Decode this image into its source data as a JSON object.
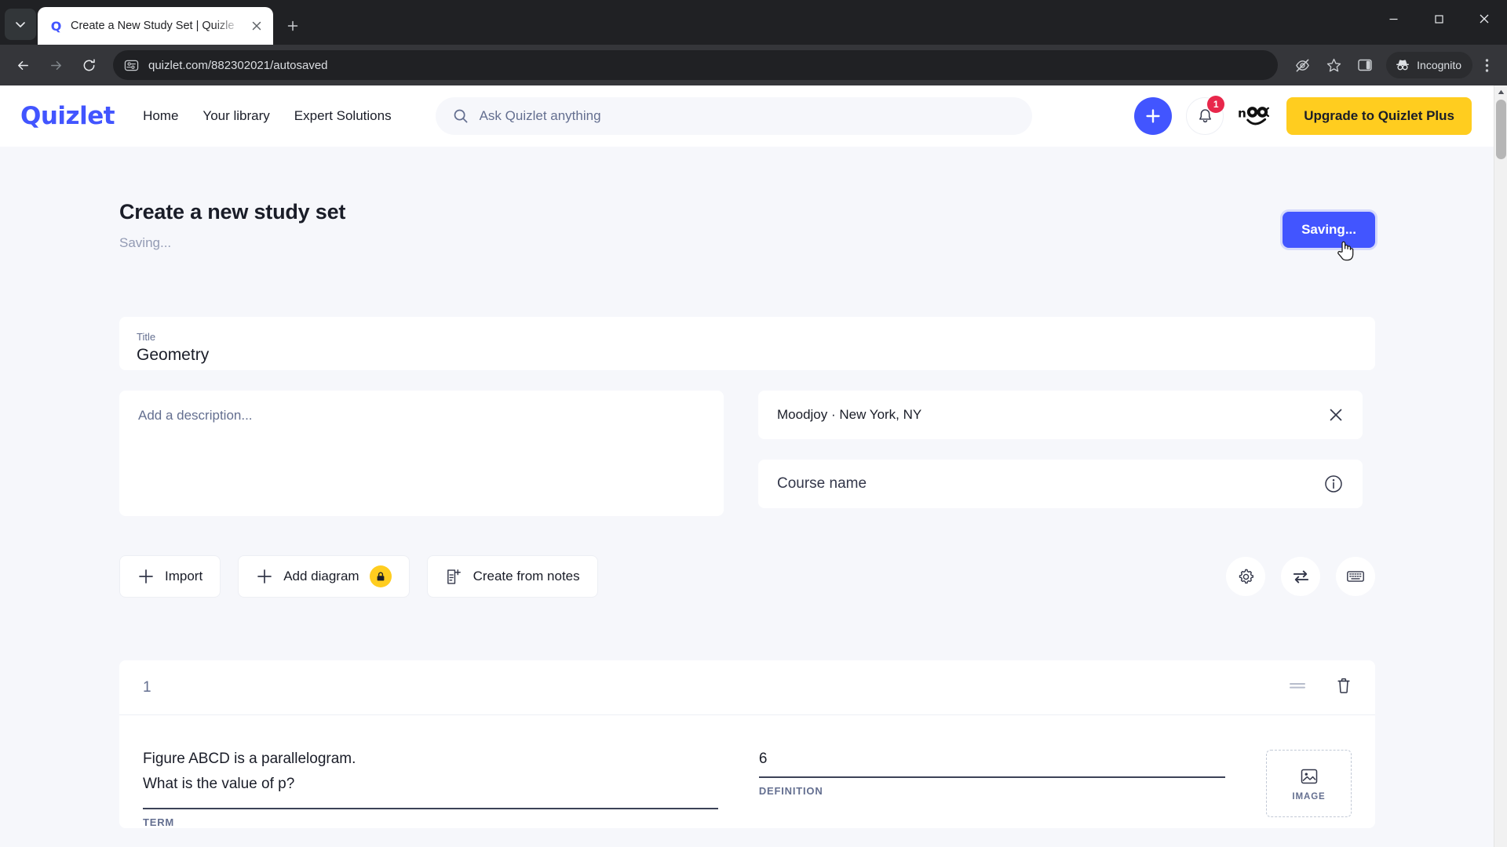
{
  "browser": {
    "tab": {
      "title": "Create a New Study Set | Quizle",
      "favicon": "Q"
    },
    "new_tab_label": "+",
    "window": {
      "minimize": "−",
      "maximize": "□",
      "close": "✕"
    },
    "url": "quizlet.com/882302021/autosaved",
    "incognito_label": "Incognito"
  },
  "header": {
    "logo": "Quizlet",
    "nav": [
      {
        "label": "Home"
      },
      {
        "label": "Your library"
      },
      {
        "label": "Expert Solutions"
      }
    ],
    "search_placeholder": "Ask Quizlet anything",
    "notification_count": "1",
    "upgrade_label": "Upgrade to Quizlet Plus"
  },
  "page": {
    "title": "Create a new study set",
    "saving_status": "Saving...",
    "save_button": "Saving...",
    "title_field": {
      "label": "Title",
      "value": "Geometry"
    },
    "description_placeholder": "Add a description...",
    "school_field": {
      "value": "Moodjoy · New York, NY"
    },
    "course_field": {
      "placeholder": "Course name"
    },
    "actions": [
      {
        "label": "Import",
        "icon": "plus-icon",
        "locked": false
      },
      {
        "label": "Add diagram",
        "icon": "plus-icon",
        "locked": true
      },
      {
        "label": "Create from notes",
        "icon": "notes-icon",
        "locked": false
      }
    ],
    "tool_icons": [
      {
        "name": "settings-gear-icon"
      },
      {
        "name": "swap-arrows-icon"
      },
      {
        "name": "keyboard-icon"
      }
    ],
    "cards": [
      {
        "number": "1",
        "term": "Figure ABCD is a parallelogram.\nWhat is the value of p?",
        "term_label": "TERM",
        "definition": "6",
        "definition_label": "DEFINITION",
        "image_label": "IMAGE"
      }
    ]
  },
  "colors": {
    "brand_blue": "#4255ff",
    "plus_yellow": "#ffcd1f",
    "badge_red": "#e8274b",
    "page_bg": "#f6f7fb"
  }
}
